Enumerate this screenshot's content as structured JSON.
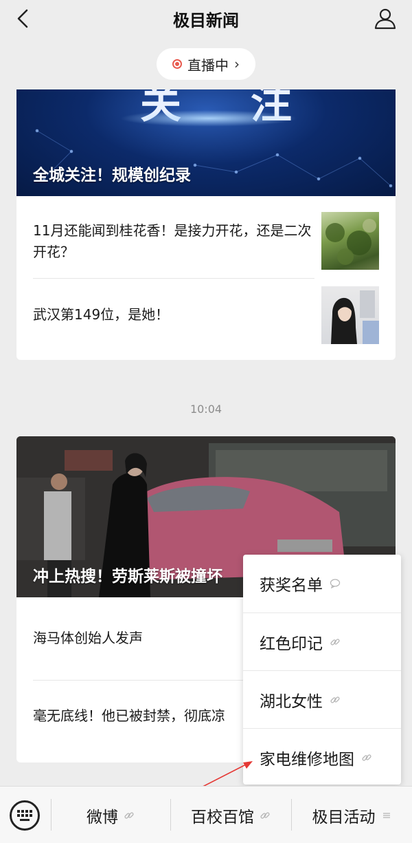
{
  "header": {
    "title": "极目新闻",
    "back_icon": "chevron-left-icon",
    "user_icon": "user-icon"
  },
  "live": {
    "label": "直播中",
    "chevron": "›",
    "accent": "#e85a4f"
  },
  "card1": {
    "hero_big_text": "关 注",
    "hero_caption": "全城关注！规模创纪录",
    "items": [
      {
        "text": "11月还能闻到桂花香！是接力开花，还是二次开花？"
      },
      {
        "text": "武汉第149位，是她！"
      }
    ]
  },
  "timestamp": "10:04",
  "card2": {
    "hero_caption": "冲上热搜！劳斯莱斯被撞坏",
    "items": [
      {
        "text": "海马体创始人发声"
      },
      {
        "text": "毫无底线！他已被封禁，彻底凉"
      }
    ]
  },
  "popup_menu": {
    "items": [
      {
        "label": "获奖名单",
        "icon": "chat-bubble-icon"
      },
      {
        "label": "红色印记",
        "icon": "link-icon"
      },
      {
        "label": "湖北女性",
        "icon": "link-icon"
      },
      {
        "label": "家电维修地图",
        "icon": "link-icon"
      }
    ]
  },
  "bottom_bar": {
    "keyboard_icon": "keyboard-icon",
    "tabs": [
      {
        "label": "微博",
        "icon": "link-icon"
      },
      {
        "label": "百校百馆",
        "icon": "link-icon"
      },
      {
        "label": "极目活动",
        "icon": "menu-lines-icon"
      }
    ]
  },
  "annotation": {
    "arrow_color": "#e53935"
  }
}
